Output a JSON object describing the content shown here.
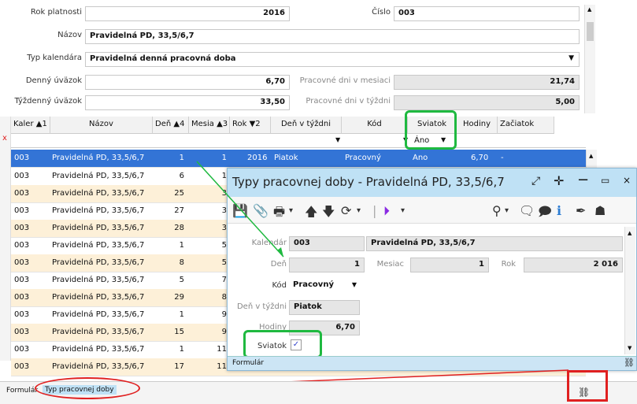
{
  "form": {
    "rok_label": "Rok platnosti",
    "rok_value": "2016",
    "cislo_label": "Číslo",
    "cislo_value": "003",
    "nazov_label": "Názov",
    "nazov_value": "Pravidelná PD, 33,5/6,7",
    "typ_label": "Typ kalendára",
    "typ_value": "Pravidelná denná pracovná doba",
    "denny_label": "Denný úväzok",
    "denny_value": "6,70",
    "tyzdenny_label": "Týždenný úväzok",
    "tyzdenny_value": "33,50",
    "dni_mesiac_label": "Pracovné dni v mesiaci",
    "dni_mesiac_value": "21,74",
    "dni_tyzden_label": "Pracovné dni v týždni",
    "dni_tyzden_value": "5,00"
  },
  "grid": {
    "headers": {
      "kaler": "Kaler",
      "kaler_sort": "▲1",
      "nazov": "Názov",
      "den": "Deň",
      "den_sort": "▲4",
      "mesia": "Mesia",
      "mesia_sort": "▲3",
      "rok": "Rok",
      "rok_sort": "▼2",
      "den_tyzden": "Deň v týždni",
      "kod": "Kód",
      "sviatok": "Sviatok",
      "hodiny": "Hodiny",
      "zaciatok": "Začiatok"
    },
    "filter_sviatok": "Áno",
    "selected": {
      "kaler": "003",
      "nazov": "Pravidelná PD, 33,5/6,7",
      "den": "1",
      "mesia": "1",
      "rok": "2016",
      "den_tyzden": "Piatok",
      "kod": "Pracovný",
      "sviatok": "Áno",
      "hodiny": "6,70",
      "zaciatok": "-"
    },
    "rows": [
      {
        "kaler": "003",
        "nazov": "Pravidelná PD, 33,5/6,7",
        "den": "6",
        "mesia": "1"
      },
      {
        "kaler": "003",
        "nazov": "Pravidelná PD, 33,5/6,7",
        "den": "25",
        "mesia": "3"
      },
      {
        "kaler": "003",
        "nazov": "Pravidelná PD, 33,5/6,7",
        "den": "27",
        "mesia": "3"
      },
      {
        "kaler": "003",
        "nazov": "Pravidelná PD, 33,5/6,7",
        "den": "28",
        "mesia": "3"
      },
      {
        "kaler": "003",
        "nazov": "Pravidelná PD, 33,5/6,7",
        "den": "1",
        "mesia": "5"
      },
      {
        "kaler": "003",
        "nazov": "Pravidelná PD, 33,5/6,7",
        "den": "8",
        "mesia": "5"
      },
      {
        "kaler": "003",
        "nazov": "Pravidelná PD, 33,5/6,7",
        "den": "5",
        "mesia": "7"
      },
      {
        "kaler": "003",
        "nazov": "Pravidelná PD, 33,5/6,7",
        "den": "29",
        "mesia": "8"
      },
      {
        "kaler": "003",
        "nazov": "Pravidelná PD, 33,5/6,7",
        "den": "1",
        "mesia": "9"
      },
      {
        "kaler": "003",
        "nazov": "Pravidelná PD, 33,5/6,7",
        "den": "15",
        "mesia": "9"
      },
      {
        "kaler": "003",
        "nazov": "Pravidelná PD, 33,5/6,7",
        "den": "1",
        "mesia": "11"
      },
      {
        "kaler": "003",
        "nazov": "Pravidelná PD, 33,5/6,7",
        "den": "17",
        "mesia": "11"
      }
    ]
  },
  "popup": {
    "title": "Typy pracovnej doby - Pravidelná PD, 33,5/6,7",
    "kalendar_label": "Kalendár",
    "kalendar_value": "003",
    "kalendar_name": "Pravidelná PD, 33,5/6,7",
    "den_label": "Deň",
    "den_value": "1",
    "mesiac_label": "Mesiac",
    "mesiac_value": "1",
    "rok_label": "Rok",
    "rok_value": "2 016",
    "kod_label": "Kód",
    "kod_value": "Pracovný",
    "den_tyzden_label": "Deň v týždni",
    "den_tyzden_value": "Piatok",
    "hodiny_label": "Hodiny",
    "hodiny_value": "6,70",
    "sviatok_label": "Sviatok",
    "sviatok_check": "✓",
    "tab_formular": "Formulár"
  },
  "status": {
    "formular": "Formulár",
    "typ": "Typ pracovnej doby"
  },
  "colors": {
    "accent_green": "#1fb940",
    "accent_red": "#e02020",
    "selection": "#3374d6",
    "popup_title_bg": "#bfe1f5"
  }
}
